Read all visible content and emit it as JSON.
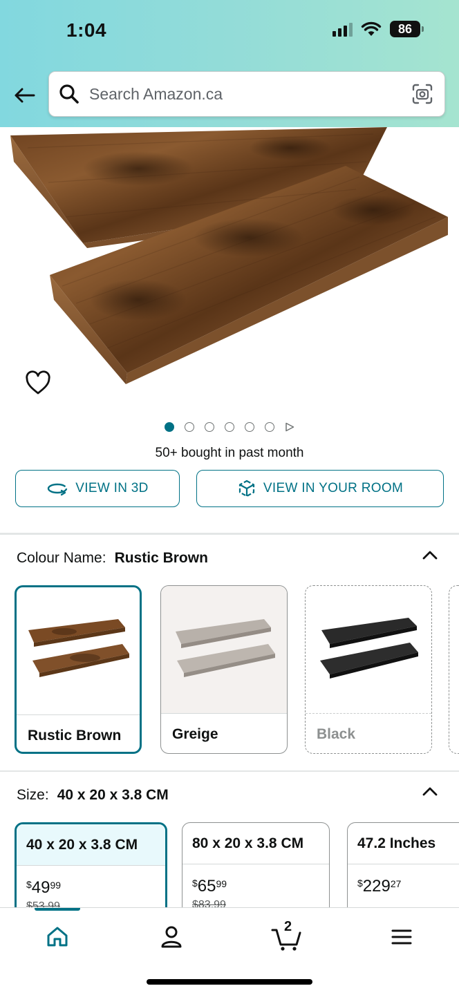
{
  "status_bar": {
    "time": "1:04",
    "battery": "86"
  },
  "search": {
    "placeholder": "Search Amazon.ca"
  },
  "gallery": {
    "image_count": 6,
    "active_index": 0
  },
  "social_proof": "50+ bought in past month",
  "buttons": {
    "view_3d": "VIEW IN 3D",
    "view_room": "VIEW IN YOUR ROOM"
  },
  "colour": {
    "label": "Colour Name:",
    "selected": "Rustic Brown",
    "options": [
      {
        "name": "Rustic Brown",
        "state": "selected"
      },
      {
        "name": "Greige",
        "state": "available"
      },
      {
        "name": "Black",
        "state": "unavailable"
      }
    ]
  },
  "size": {
    "label": "Size:",
    "selected": "40 x 20 x 3.8 CM",
    "options": [
      {
        "name": "40 x 20 x 3.8 CM",
        "currency": "$",
        "price_whole": "49",
        "price_fraction": "99",
        "was": "$53.99"
      },
      {
        "name": "80 x 20 x 3.8 CM",
        "currency": "$",
        "price_whole": "65",
        "price_fraction": "99",
        "was": "$83.99"
      },
      {
        "name": "47.2 Inches",
        "currency": "$",
        "price_whole": "229",
        "price_fraction": "27",
        "was": ""
      }
    ]
  },
  "tabbar": {
    "cart_count": "2",
    "active": "home"
  },
  "colors": {
    "accent": "#007185",
    "header_start": "#82d8df",
    "header_end": "#a5e4d0"
  }
}
